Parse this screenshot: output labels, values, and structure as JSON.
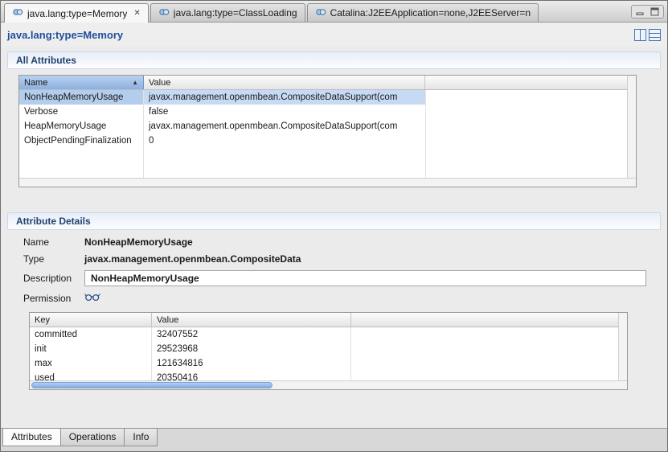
{
  "top_tabs": {
    "tabs": [
      {
        "label": "java.lang:type=Memory"
      },
      {
        "label": "java.lang:type=ClassLoading"
      },
      {
        "label": "Catalina:J2EEApplication=none,J2EEServer=n"
      }
    ]
  },
  "view": {
    "title": "java.lang:type=Memory"
  },
  "icons": {
    "sort_asc": "▲",
    "close": "✕"
  },
  "all_attributes": {
    "title": "All Attributes",
    "columns": {
      "name": "Name",
      "value": "Value"
    },
    "rows": [
      {
        "name": "NonHeapMemoryUsage",
        "value": "javax.management.openmbean.CompositeDataSupport(com"
      },
      {
        "name": "Verbose",
        "value": "false"
      },
      {
        "name": "HeapMemoryUsage",
        "value": "javax.management.openmbean.CompositeDataSupport(com"
      },
      {
        "name": "ObjectPendingFinalization",
        "value": "0"
      }
    ]
  },
  "details": {
    "title": "Attribute Details",
    "fields": {
      "name_label": "Name",
      "name_value": "NonHeapMemoryUsage",
      "type_label": "Type",
      "type_value": "javax.management.openmbean.CompositeData",
      "description_label": "Description",
      "description_value": "NonHeapMemoryUsage",
      "permission_label": "Permission"
    },
    "key_table": {
      "columns": {
        "key": "Key",
        "value": "Value"
      },
      "rows": [
        {
          "key": "committed",
          "value": "32407552"
        },
        {
          "key": "init",
          "value": "29523968"
        },
        {
          "key": "max",
          "value": "121634816"
        },
        {
          "key": "used",
          "value": "20350416"
        }
      ]
    }
  },
  "bottom_tabs": [
    {
      "label": "Attributes"
    },
    {
      "label": "Operations"
    },
    {
      "label": "Info"
    }
  ],
  "colors": {
    "accent_blue": "#1f4e9c",
    "selection": "#c7daf3",
    "selection_dark": "#b3cdec",
    "sorted_top": "#b9d0f0",
    "sorted_bottom": "#8cb0e0"
  }
}
